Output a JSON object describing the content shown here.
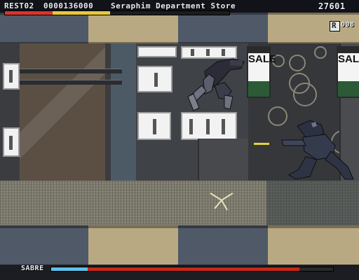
{
  "hud": {
    "rest_label": "REST02",
    "score": "0000136000",
    "location": "Seraphim Department Store",
    "timer": "27601",
    "item_key": "R",
    "item_count": "008",
    "player_health": 0.47,
    "boss_label": "SABRE",
    "boss_health": 0.88
  },
  "signs": {
    "sale_left": "SALE",
    "sale_right": "SALE"
  },
  "colors": {
    "health_red": "#d8352e",
    "health_yellow": "#e7c73a",
    "boss_blue": "#5fc0e8",
    "boss_red": "#c8271c",
    "sale_green": "#2b5b36"
  },
  "icons": [
    "item-r-icon",
    "enemy-robot-icon",
    "ninja-player-icon",
    "shuriken-icon"
  ]
}
